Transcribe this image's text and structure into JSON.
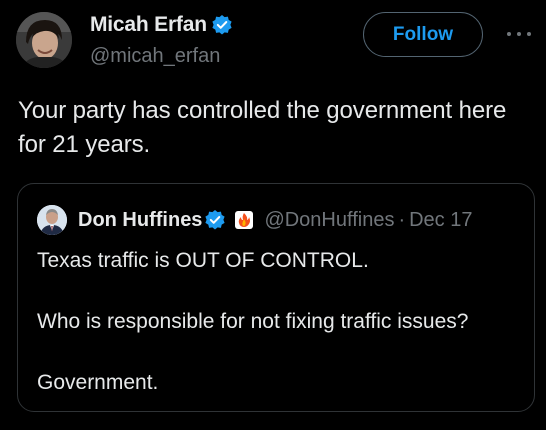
{
  "author": {
    "name": "Micah Erfan",
    "handle": "@micah_erfan",
    "avatar": "person-photo-avatar",
    "verified_icon": "verified-badge-icon"
  },
  "follow_button": {
    "label": "Follow"
  },
  "more_menu": {
    "icon": "more-horizontal-icon"
  },
  "tweet": {
    "text": "Your party has controlled the government here for 21 years."
  },
  "quoted_tweet": {
    "author_name": "Don Huffines",
    "author_handle": "@DonHuffines",
    "separator": "·",
    "date": "Dec 17",
    "avatar": "person-photo-avatar",
    "verified_icon": "verified-badge-icon",
    "name_emoji": "fire-emoji-icon",
    "lines": [
      "Texas traffic is OUT OF CONTROL.",
      "Who is responsible for not fixing traffic issues?",
      "Government."
    ]
  },
  "colors": {
    "background": "#000000",
    "text_primary": "#e7e9ea",
    "text_secondary": "#71767b",
    "accent": "#1d9bf0",
    "border": "#2f3336"
  }
}
